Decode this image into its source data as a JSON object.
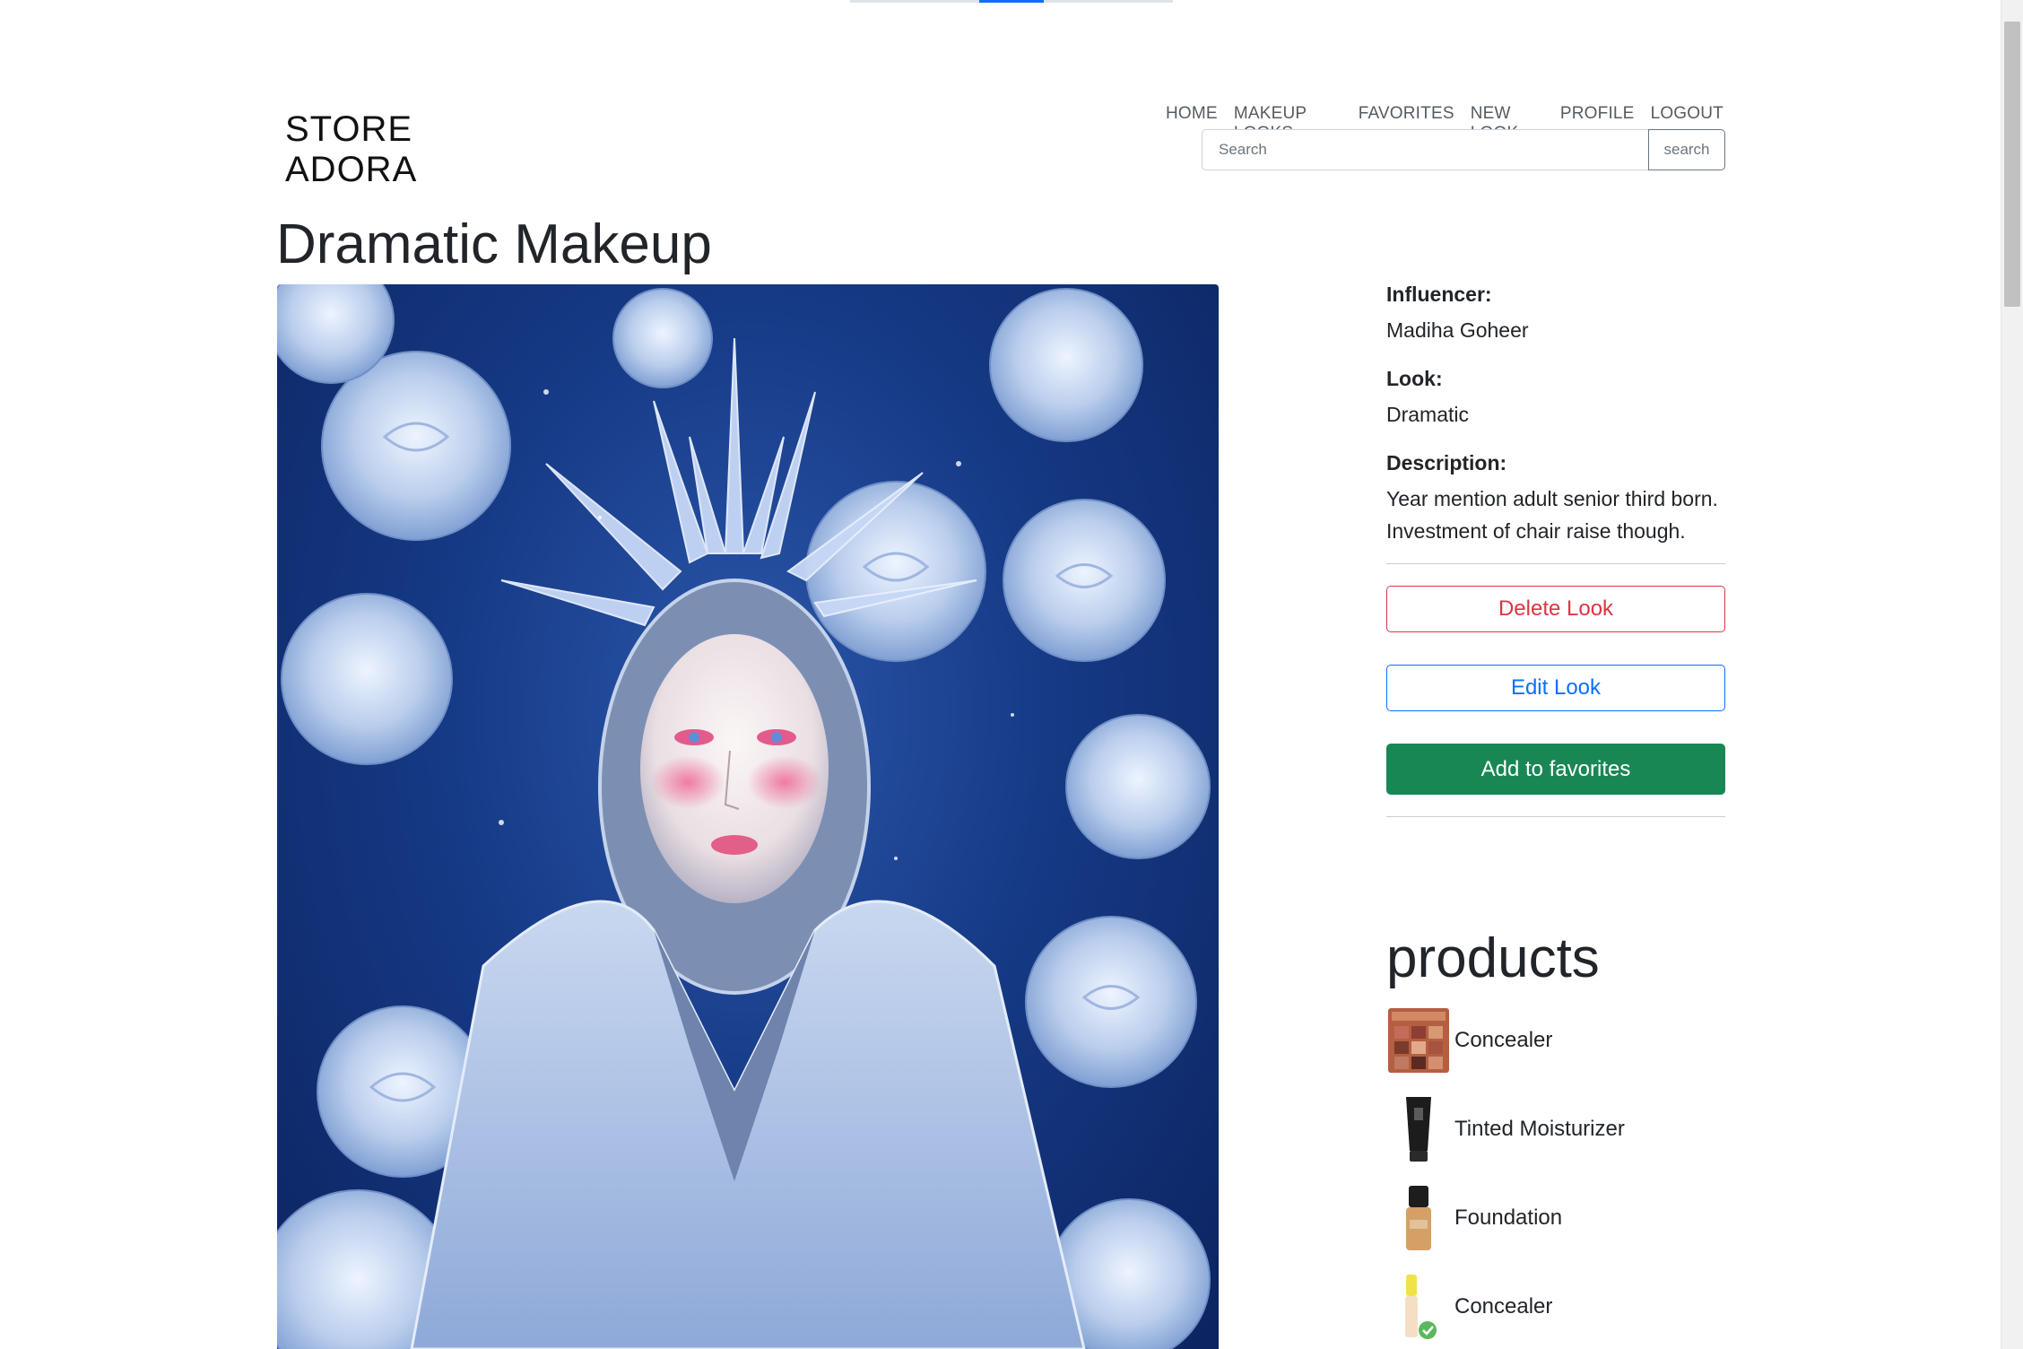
{
  "brand": {
    "line1": "STORE",
    "line2": "ADORA"
  },
  "nav": {
    "items": [
      {
        "label": "HOME"
      },
      {
        "label": "MAKEUP LOOKS"
      },
      {
        "label": "FAVORITES"
      },
      {
        "label": "NEW LOOK"
      },
      {
        "label": "PROFILE"
      },
      {
        "label": "LOGOUT"
      }
    ]
  },
  "search": {
    "placeholder": "Search",
    "value": "",
    "button_label": "search"
  },
  "look": {
    "title": "Dramatic Makeup",
    "image_icon": "portrait-photo-icon",
    "influencer_label": "Influencer:",
    "influencer": "Madiha Goheer",
    "look_label": "Look:",
    "look_type": "Dramatic",
    "description_label": "Description:",
    "description": "Year mention adult senior third born. Investment of chair raise though."
  },
  "actions": {
    "delete_label": "Delete Look",
    "edit_label": "Edit Look",
    "favorite_label": "Add to favorites"
  },
  "products": {
    "heading": "products",
    "items": [
      {
        "name": "Concealer",
        "thumb_icon": "eyeshadow-palette-icon"
      },
      {
        "name": "Tinted Moisturizer",
        "thumb_icon": "moisturizer-tube-icon"
      },
      {
        "name": "Foundation",
        "thumb_icon": "foundation-bottle-icon"
      },
      {
        "name": "Concealer",
        "thumb_icon": "concealer-wand-icon"
      }
    ]
  },
  "colors": {
    "delete": "#dc3545",
    "edit": "#0d6efd",
    "favorite": "#198754",
    "image_background": "#163a86"
  }
}
